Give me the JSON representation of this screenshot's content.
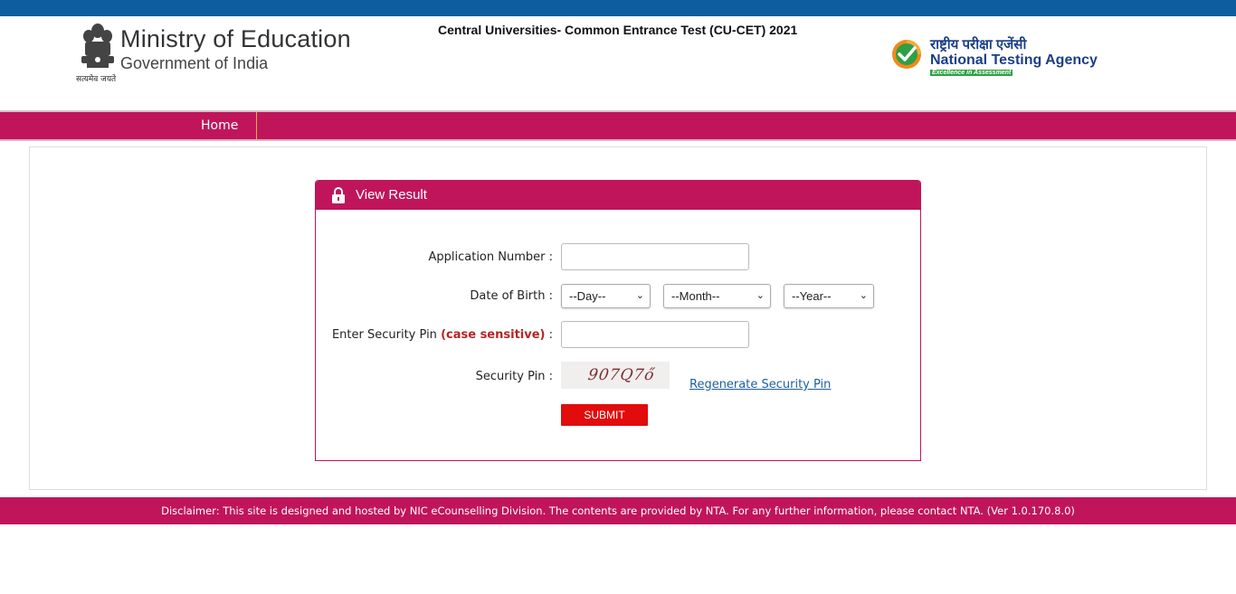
{
  "header": {
    "emblem_caption": "सत्यमेव जयते",
    "ministry_title": "Ministry of Education",
    "ministry_subtitle": "Government of India",
    "exam_title": "Central Universities- Common Entrance Test (CU-CET) 2021",
    "nta_hindi": "राष्ट्रीय परीक्षा एजेंसी",
    "nta_name": "National Testing Agency",
    "nta_tagline": "Excellence in Assessment"
  },
  "nav": {
    "home_label": "Home"
  },
  "panel": {
    "title": "View Result",
    "lock_icon": "lock-icon",
    "application_label": "Application Number :",
    "dob_label": "Date of Birth :",
    "day_selected": "--Day--",
    "month_selected": "--Month--",
    "year_selected": "--Year--",
    "security_label_main": "Enter Security Pin",
    "security_label_hint": "(case sensitive)",
    "security_label_colon": " :",
    "captcha_label": "Security Pin :",
    "captcha_text": "907Q7ő",
    "regenerate_label": "Regenerate Security Pin",
    "submit_label": "SUBMIT"
  },
  "footer": {
    "disclaimer": "Disclaimer: This site is designed and hosted by NIC eCounselling Division. The contents are provided by NTA. For any further information, please contact NTA. (Ver 1.0.170.8.0)"
  },
  "colors": {
    "brand": "#c0155a",
    "topbar": "#0c5e9c",
    "submit": "#e20c0c",
    "link": "#1c5f9e"
  }
}
